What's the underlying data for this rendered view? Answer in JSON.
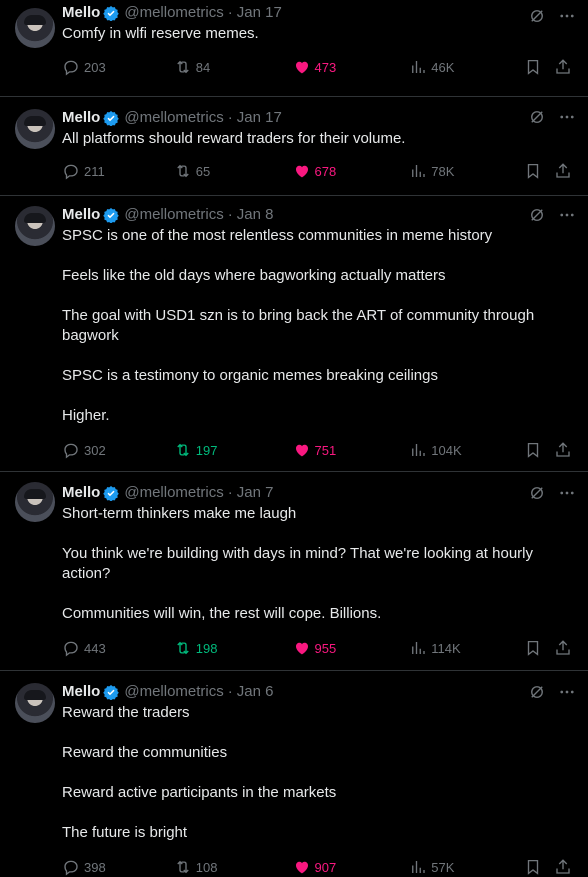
{
  "colors": {
    "background": "#000000",
    "text": "#e7e9ea",
    "muted": "#71767b",
    "verified": "#1d9bf0",
    "like": "#f91880",
    "retweet_active": "#00ba7c"
  },
  "tweets": [
    {
      "name": "Mello",
      "handle": "@mellometrics",
      "date": "Jan 17",
      "paragraphs": [
        "Comfy in wlfi reserve memes."
      ],
      "replies": "203",
      "retweets": "84",
      "likes": "473",
      "views": "46K",
      "retweet_active": false
    },
    {
      "name": "Mello",
      "handle": "@mellometrics",
      "date": "Jan 17",
      "paragraphs": [
        "All platforms should reward traders for their volume."
      ],
      "replies": "211",
      "retweets": "65",
      "likes": "678",
      "views": "78K",
      "retweet_active": false
    },
    {
      "name": "Mello",
      "handle": "@mellometrics",
      "date": "Jan 8",
      "paragraphs": [
        "SPSC is one of the most relentless communities in meme history",
        "Feels like the old days where bagworking actually matters",
        "The goal with USD1 szn is to bring back the ART of community through bagwork",
        "SPSC is a testimony to organic memes breaking ceilings",
        "Higher."
      ],
      "replies": "302",
      "retweets": "197",
      "likes": "751",
      "views": "104K",
      "retweet_active": true
    },
    {
      "name": "Mello",
      "handle": "@mellometrics",
      "date": "Jan 7",
      "paragraphs": [
        "Short-term thinkers make me laugh",
        "You think we're building with days in mind? That we're looking at hourly action?",
        "Communities will win, the rest will cope. Billions."
      ],
      "replies": "443",
      "retweets": "198",
      "likes": "955",
      "views": "114K",
      "retweet_active": true
    },
    {
      "name": "Mello",
      "handle": "@mellometrics",
      "date": "Jan 6",
      "paragraphs": [
        "Reward the traders",
        "Reward the communities",
        "Reward active participants in the markets",
        "The future is bright"
      ],
      "replies": "398",
      "retweets": "108",
      "likes": "907",
      "views": "57K",
      "retweet_active": false
    }
  ]
}
